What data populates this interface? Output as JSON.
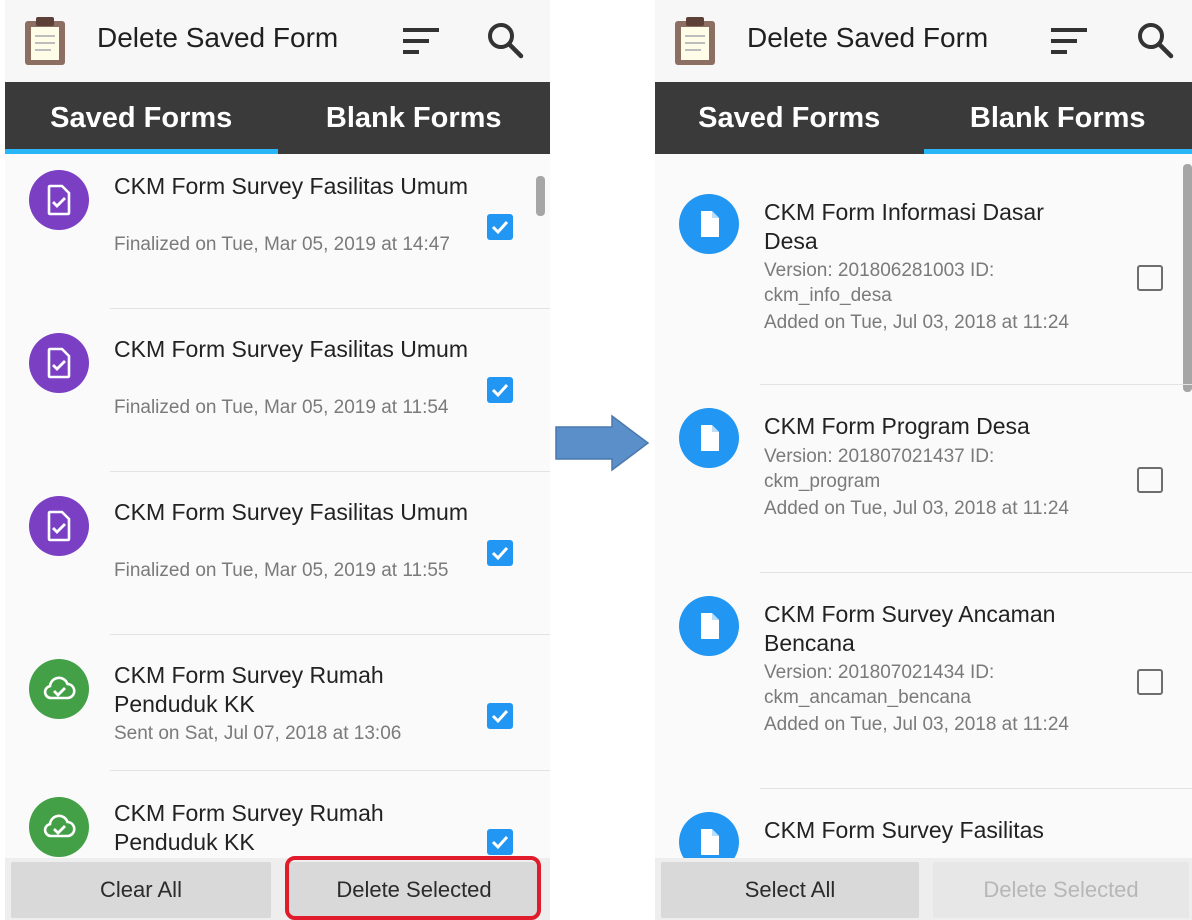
{
  "left": {
    "title": "Delete Saved Form",
    "tabs": [
      {
        "label": "Saved Forms"
      },
      {
        "label": "Blank Forms"
      }
    ],
    "active_tab": 0,
    "items": [
      {
        "name": "CKM Form Survey Fasilitas Umum",
        "status": "Finalized on Tue, Mar 05, 2019 at 14:47",
        "icon": "finalized-form-icon",
        "checked": true
      },
      {
        "name": "CKM Form Survey Fasilitas Umum",
        "status": "Finalized on Tue, Mar 05, 2019 at 11:54",
        "icon": "finalized-form-icon",
        "checked": true
      },
      {
        "name": "CKM Form Survey Fasilitas Umum",
        "status": "Finalized on Tue, Mar 05, 2019 at 11:55",
        "icon": "finalized-form-icon",
        "checked": true
      },
      {
        "name": "CKM Form Survey Rumah Penduduk KK",
        "status": "Sent on Sat, Jul 07, 2018 at 13:06",
        "icon": "cloud-sent-icon",
        "checked": true
      },
      {
        "name": "CKM Form Survey Rumah Penduduk KK",
        "status": "",
        "icon": "cloud-sent-icon",
        "checked": true
      }
    ],
    "buttons": {
      "clear_all": "Clear All",
      "delete_selected": "Delete Selected"
    }
  },
  "right": {
    "title": "Delete Saved Form",
    "tabs": [
      {
        "label": "Saved Forms"
      },
      {
        "label": "Blank Forms"
      }
    ],
    "active_tab": 1,
    "items": [
      {
        "name": "CKM Form Informasi Dasar Desa",
        "version": "Version: 201806281003 ID: ckm_info_desa",
        "added": "Added on Tue, Jul 03, 2018 at 11:24",
        "checked": false
      },
      {
        "name": "CKM Form Program Desa",
        "version": "Version: 201807021437 ID: ckm_program",
        "added": "Added on Tue, Jul 03, 2018 at 11:24",
        "checked": false
      },
      {
        "name": "CKM Form Survey Ancaman Bencana",
        "version": "Version: 201807021434 ID: ckm_ancaman_bencana",
        "added": "Added on Tue, Jul 03, 2018 at 11:24",
        "checked": false
      },
      {
        "name": "CKM Form Survey Fasilitas",
        "version": "",
        "added": "",
        "checked": false
      }
    ],
    "buttons": {
      "select_all": "Select All",
      "delete_selected": "Delete Selected"
    }
  },
  "colors": {
    "tab_bar": "#3a3a3a",
    "tab_indicator": "#29b6f6",
    "checkbox_checked": "#2196f3",
    "finalized_icon": "#7b3fc4",
    "sent_icon": "#43a047",
    "blank_form_icon": "#2196f3",
    "highlight_ring": "#e01b2b",
    "arrow": "#5b8fc9"
  }
}
